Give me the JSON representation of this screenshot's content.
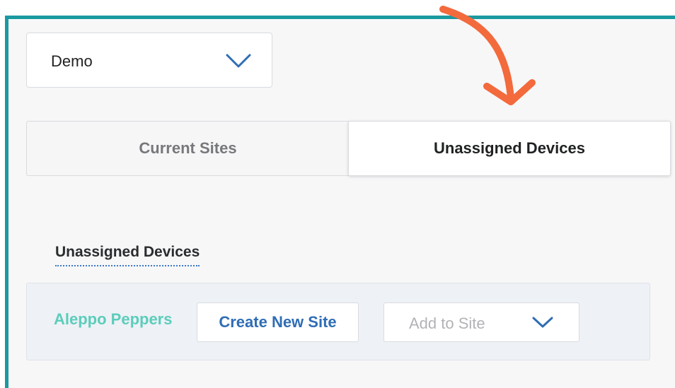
{
  "site_selector": {
    "value": "Demo",
    "icon": "chevron-down-icon"
  },
  "tabs": [
    {
      "label": "Current Sites",
      "active": false
    },
    {
      "label": "Unassigned Devices",
      "active": true
    }
  ],
  "section": {
    "heading": "Unassigned Devices"
  },
  "devices": [
    {
      "name": "Aleppo Peppers",
      "create_label": "Create New Site",
      "add_placeholder": "Add to Site"
    }
  ],
  "colors": {
    "frame_border": "#1b99a1",
    "annotation_arrow": "#f36a3c",
    "device_name": "#5ccdbb",
    "link_blue": "#2f6db5"
  }
}
